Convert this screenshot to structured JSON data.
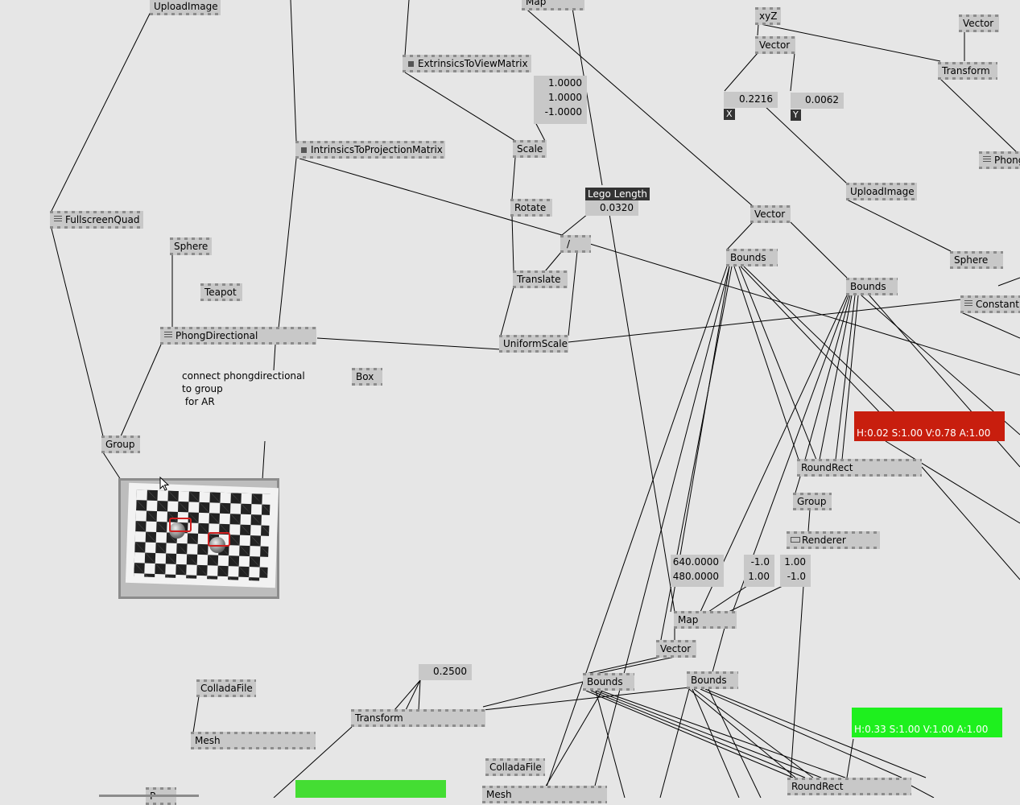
{
  "nodes": {
    "upload_image_top": "UploadImage",
    "map_top": "Map",
    "xyz": "xyZ",
    "vector_top_right": "Vector",
    "vector_a": "Vector",
    "transform_top_right": "Transform",
    "extrinsics": "ExtrinsicsToViewMatrix",
    "intrinsics": "IntrinsicsToProjectionMatrix",
    "scale": "Scale",
    "rotate": "Rotate",
    "translate": "Translate",
    "uniform_scale": "UniformScale",
    "divide": "/",
    "phong_right": "Phong",
    "upload_image_right": "UploadImage",
    "vector_b": "Vector",
    "bounds_a": "Bounds",
    "bounds_b": "Bounds",
    "sphere_right": "Sphere",
    "constant": "Constant",
    "fullscreen_quad": "FullscreenQuad",
    "sphere_left": "Sphere",
    "teapot": "Teapot",
    "phong_directional": "PhongDirectional",
    "box": "Box",
    "group_left": "Group",
    "round_rect_a": "RoundRect",
    "group_right": "Group",
    "renderer": "Renderer",
    "map_mid": "Map",
    "vector_c": "Vector",
    "bounds_c": "Bounds",
    "bounds_d": "Bounds",
    "collada_file_left": "ColladaFile",
    "mesh_left": "Mesh",
    "transform_bottom": "Transform",
    "collada_file_bottom": "ColladaFile",
    "mesh_bottom": "Mesh",
    "round_rect_b": "RoundRect",
    "partial_bottom_left": "P"
  },
  "values": {
    "matrix_vector": "1.0000\n1.0000\n-1.0000",
    "x_value": "0.2216",
    "y_value": "0.0062",
    "x_tag": "X",
    "y_tag": "Y",
    "lego_length_label": "Lego Length",
    "lego_length_value": "0.0320",
    "resolution": "640.0000\n480.0000",
    "range_a": "-1.0\n1.00",
    "range_b": "1.00\n-1.0",
    "scale_value": "0.2500"
  },
  "note": "connect phongdirectional\nto group\n for AR",
  "colors": {
    "red_swatch": {
      "hex": "#c81e0e",
      "text": "H:0.02  S:1.00  V:0.78  A:1.00"
    },
    "green_swatch": {
      "hex": "#1ef01e",
      "text": "H:0.33  S:1.00  V:1.00  A:1.00"
    },
    "green_strip": {
      "hex": "#44dd33"
    }
  },
  "icons": {
    "square": "square-port-icon",
    "menu": "menu-lines-icon",
    "window": "window-icon",
    "cursor": "mouse-cursor-icon"
  }
}
